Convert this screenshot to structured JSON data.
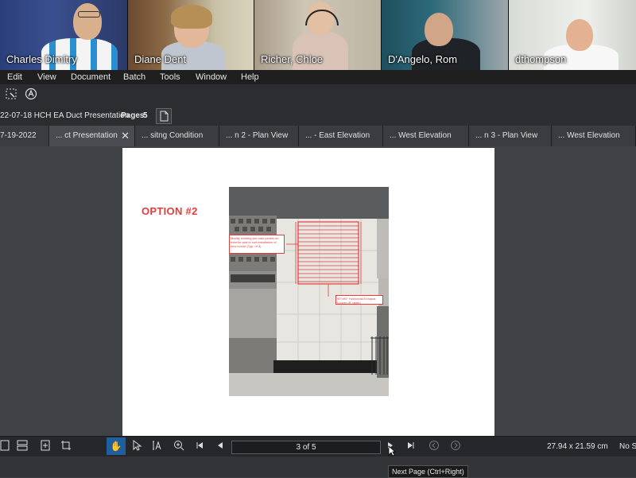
{
  "participants": [
    {
      "name": "Charles Dimitry"
    },
    {
      "name": "Diane Dent"
    },
    {
      "name": "Richer, Chloe"
    },
    {
      "name": "D'Angelo, Rom"
    },
    {
      "name": "dthompson"
    }
  ],
  "menu": [
    "Edit",
    "View",
    "Document",
    "Batch",
    "Tools",
    "Window",
    "Help"
  ],
  "document": {
    "title": "22-07-18 HCH EA Duct Presentation",
    "pages_label": "Pages:",
    "pages_count": "5"
  },
  "tabs": [
    {
      "label": "7-19-2022"
    },
    {
      "label": "... ct Presentation"
    },
    {
      "label": "... sitng Condition"
    },
    {
      "label": "... n 2 - Plan View"
    },
    {
      "label": "... - East Elevation"
    },
    {
      "label": "... West Elevation"
    },
    {
      "label": "... n 3 - Plan View"
    },
    {
      "label": "... West Elevation"
    }
  ],
  "page_content": {
    "title": "OPTION #2",
    "callout_1": "Modify existing pre-cast panels on exterior wall to suit installation of new louvre (Typ. of 3)",
    "callout_2": "90\"x90\" Horizontal Exhaust Louver (8\" deep)"
  },
  "status": {
    "page_indicator": "3 of 5",
    "dimensions": "27.94 x 21.59 cm",
    "snap": "No S",
    "tooltip": "Next Page (Ctrl+Right)"
  },
  "colors": {
    "accent": "#e53b3b",
    "active_tool": "#1f5f9e"
  }
}
